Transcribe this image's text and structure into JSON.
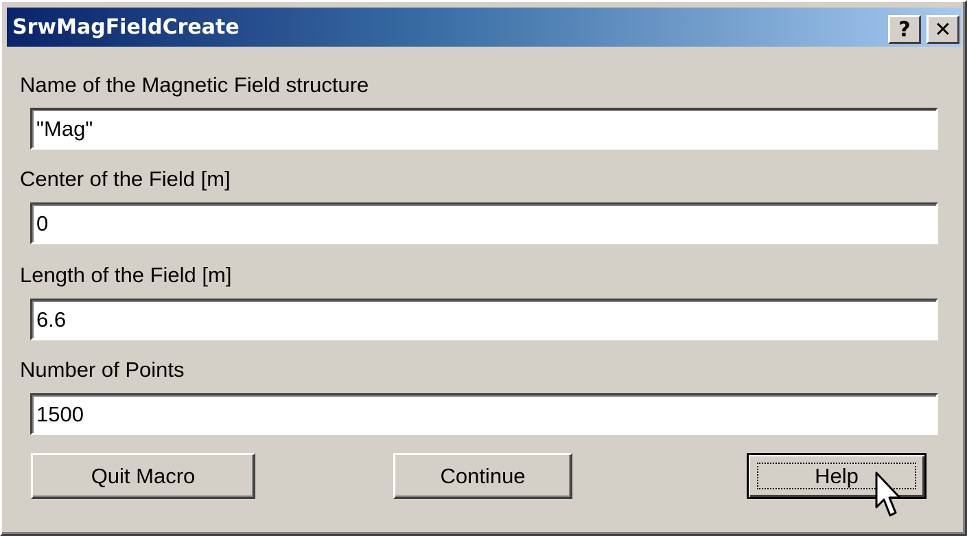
{
  "window": {
    "title": "SrwMagFieldCreate",
    "help_glyph": "?",
    "close_glyph": "✕"
  },
  "fields": [
    {
      "label": "Name of the Magnetic Field structure",
      "value": "\"Mag\""
    },
    {
      "label": "Center of the Field [m]",
      "value": "0"
    },
    {
      "label": "Length of the Field [m]",
      "value": "6.6"
    },
    {
      "label": "Number of Points",
      "value": "1500"
    }
  ],
  "buttons": {
    "quit": "Quit Macro",
    "continue": "Continue",
    "help": "Help"
  },
  "colors": {
    "title_start": "#0a246a",
    "title_end": "#a6caf0",
    "face": "#d4d0c8"
  },
  "icons": {
    "cursor": "arrow-cursor-icon"
  }
}
